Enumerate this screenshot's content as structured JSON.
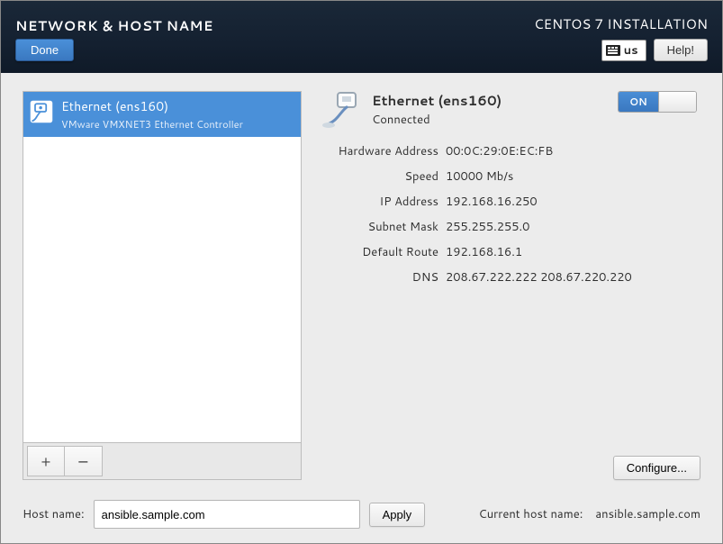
{
  "header": {
    "title_left": "NETWORK & HOST NAME",
    "title_right": "CENTOS 7 INSTALLATION",
    "done_label": "Done",
    "help_label": "Help!",
    "keyboard_layout": "us"
  },
  "interfaces": {
    "items": [
      {
        "label": "Ethernet (ens160)",
        "subtitle": "VMware VMXNET3 Ethernet Controller",
        "selected": true
      }
    ],
    "add_label": "+",
    "remove_label": "−"
  },
  "detail": {
    "title": "Ethernet (ens160)",
    "status": "Connected",
    "toggle_state": "ON",
    "toggle_on_label": "ON",
    "fields": {
      "hw_label": "Hardware Address",
      "hw_value": "00:0C:29:0E:EC:FB",
      "speed_label": "Speed",
      "speed_value": "10000 Mb/s",
      "ip_label": "IP Address",
      "ip_value": "192.168.16.250",
      "mask_label": "Subnet Mask",
      "mask_value": "255.255.255.0",
      "route_label": "Default Route",
      "route_value": "192.168.16.1",
      "dns_label": "DNS",
      "dns_value": "208.67.222.222 208.67.220.220"
    },
    "configure_label": "Configure..."
  },
  "hostname": {
    "input_label": "Host name:",
    "input_value": "ansible.sample.com",
    "apply_label": "Apply",
    "current_label": "Current host name:",
    "current_value": "ansible.sample.com"
  }
}
